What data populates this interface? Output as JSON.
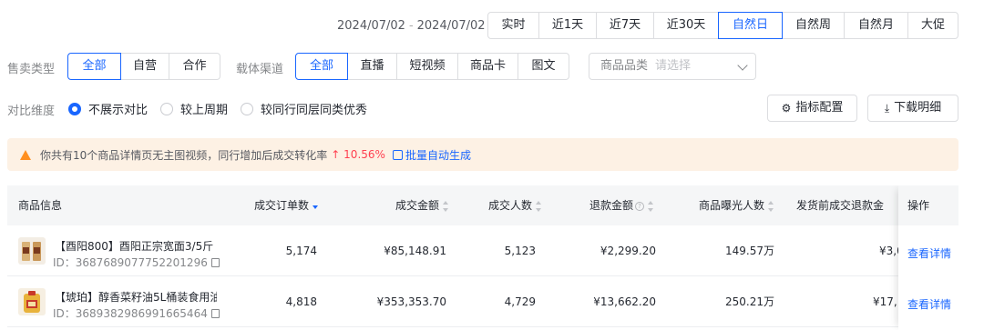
{
  "date_range": {
    "start": "2024/07/02",
    "separator": "-",
    "end": "2024/07/02"
  },
  "period_tabs": [
    "实时",
    "近1天",
    "近7天",
    "近30天",
    "自然日",
    "自然周",
    "自然月",
    "大促"
  ],
  "period_selected": "自然日",
  "sale_type": {
    "label": "售卖类型",
    "options": [
      "全部",
      "自营",
      "合作"
    ],
    "selected": "全部"
  },
  "channel": {
    "label": "载体渠道",
    "options": [
      "全部",
      "直播",
      "短视频",
      "商品卡",
      "图文"
    ],
    "selected": "全部"
  },
  "category": {
    "label": "商品品类",
    "placeholder": "请选择"
  },
  "compare": {
    "label": "对比维度",
    "options": [
      "不展示对比",
      "较上周期",
      "较同行同层同类优秀"
    ],
    "selected": "不展示对比"
  },
  "buttons": {
    "metric_config": "指标配置",
    "download": "下载明细"
  },
  "alert": {
    "text": "你共有10个商品详情页无主图视频，同行增加后成交转化率",
    "arrow": "↑",
    "rate": "10.56%",
    "link": "批量自动生成"
  },
  "table": {
    "columns": [
      "商品信息",
      "成交订单数",
      "成交金额",
      "成交人数",
      "退款金额",
      "商品曝光人数",
      "发货前成交退款金",
      "操作"
    ],
    "rows": [
      {
        "name": "【酉阳800】酉阳正宗宽面3/5斤 ...",
        "id": "ID：3687689077752201296",
        "orders": "5,174",
        "amount": "¥85,148.91",
        "buyers": "5,123",
        "refund": "¥2,299.20",
        "exposure": "149.57万",
        "pre_refund": "¥3,0",
        "action": "查看详情"
      },
      {
        "name": "【琥珀】醇香菜籽油5L桶装食用油...",
        "id": "ID：3689382986991665464",
        "orders": "4,818",
        "amount": "¥353,353.70",
        "buyers": "4,729",
        "refund": "¥13,662.20",
        "exposure": "250.21万",
        "pre_refund": "¥17,1",
        "action": "查看详情"
      }
    ]
  },
  "colors": {
    "accent": "#1966ff",
    "alert_bg": "#fdf1e4",
    "warn": "#ff8f1f",
    "rise": "#ff4050"
  }
}
